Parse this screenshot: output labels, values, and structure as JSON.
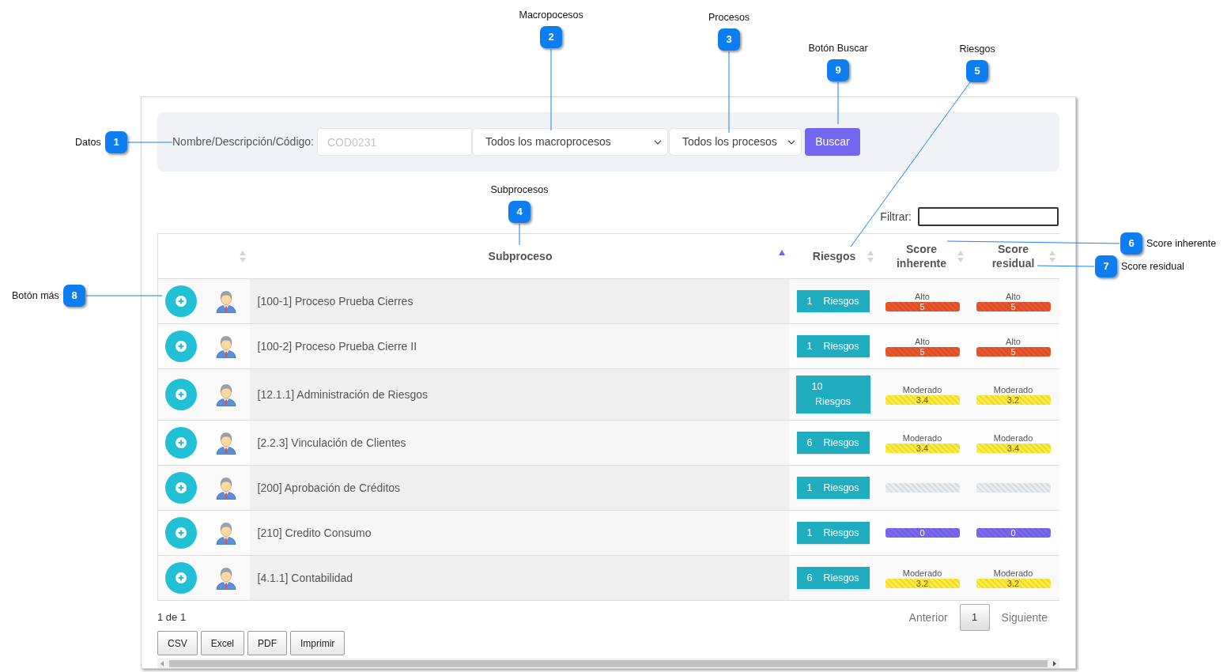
{
  "callouts": [
    {
      "number": "2",
      "label": "Macropocesos"
    },
    {
      "number": "3",
      "label": "Procesos"
    },
    {
      "number": "9",
      "label": "Botón Buscar"
    },
    {
      "number": "5",
      "label": "Riesgos"
    },
    {
      "number": "1",
      "label": "Datos"
    },
    {
      "number": "4",
      "label": "Subprocesos"
    },
    {
      "number": "6",
      "label": "Score inherente"
    },
    {
      "number": "7",
      "label": "Score residual"
    },
    {
      "number": "8",
      "label": "Botón más"
    }
  ],
  "search": {
    "label": "Nombre/Descripción/Código:",
    "placeholder": "COD0231",
    "macroprocess": "Todos los macroprocesos",
    "process": "Todos los procesos",
    "button": "Buscar"
  },
  "filter": {
    "label": "Filtrar:"
  },
  "table": {
    "columns": [
      {
        "sortable": true,
        "sorted": false
      },
      {
        "label": "Subproceso",
        "sortable": true,
        "sorted": true
      },
      {
        "label": "Riesgos",
        "sortable": true,
        "sorted": false
      },
      {
        "label": "Score inherente",
        "sortable": true,
        "sorted": false
      },
      {
        "label": "Score residual",
        "sortable": true,
        "sorted": false
      }
    ],
    "rows": [
      {
        "name": "[100-1] Proceso Prueba Cierres",
        "risk_count": "1",
        "risk_label": "Riesgos",
        "inherent": {
          "label": "Alto",
          "value": "5",
          "color": "#e9562c"
        },
        "residual": {
          "label": "Alto",
          "value": "5",
          "color": "#e9562c"
        }
      },
      {
        "name": "[100-2] Proceso Prueba Cierre II",
        "risk_count": "1",
        "risk_label": "Riesgos",
        "inherent": {
          "label": "Alto",
          "value": "5",
          "color": "#e9562c"
        },
        "residual": {
          "label": "Alto",
          "value": "5",
          "color": "#e9562c"
        }
      },
      {
        "name": "[12.1.1] Administración de Riesgos",
        "risk_count": "10",
        "risk_label": "Riesgos",
        "inherent": {
          "label": "Moderado",
          "value": "3.4",
          "color": "#ffeb3b"
        },
        "residual": {
          "label": "Moderado",
          "value": "3.2",
          "color": "#ffeb3b"
        }
      },
      {
        "name": "[2.2.3] Vinculación de Clientes",
        "risk_count": "6",
        "risk_label": "Riesgos",
        "inherent": {
          "label": "Moderado",
          "value": "3.4",
          "color": "#ffeb3b"
        },
        "residual": {
          "label": "Moderado",
          "value": "3.4",
          "color": "#ffeb3b"
        }
      },
      {
        "name": "[200] Aprobación de Créditos",
        "risk_count": "1",
        "risk_label": "Riesgos",
        "inherent": {
          "color": "#e9ecef"
        },
        "residual": {
          "color": "#e9ecef"
        }
      },
      {
        "name": "[210] Credito Consumo",
        "risk_count": "1",
        "risk_label": "Riesgos",
        "inherent": {
          "value": "0",
          "color": "#7b68ee"
        },
        "residual": {
          "value": "0",
          "color": "#7b68ee"
        }
      },
      {
        "name": "[4.1.1] Contabilidad",
        "risk_count": "6",
        "risk_label": "Riesgos",
        "inherent": {
          "label": "Moderado",
          "value": "3.2",
          "color": "#ffeb3b"
        },
        "residual": {
          "label": "Moderado",
          "value": "3.2",
          "color": "#ffeb3b"
        }
      }
    ]
  },
  "footer": {
    "info": "1 de 1",
    "previous": {
      "label": "Anterior",
      "disabled": true
    },
    "pages": [
      {
        "label": "1",
        "selected": true
      }
    ],
    "next": {
      "label": "Siguiente",
      "disabled": true
    },
    "exports": [
      "CSV",
      "Excel",
      "PDF",
      "Imprimir"
    ]
  }
}
